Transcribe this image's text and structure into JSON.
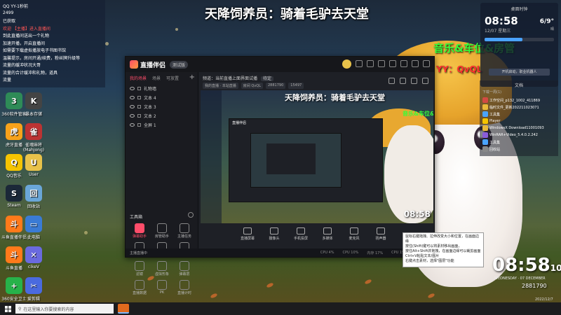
{
  "window": {
    "top_title": "天降饲养员：骑着毛驴去天堂",
    "green_overlay": "音乐&车位&房管",
    "red_overlay": "YY：QvQL"
  },
  "qq_panel": {
    "lines": [
      {
        "text": "QQ  YY-1秒前",
        "red": false
      },
      {
        "text": "2499",
        "red": false
      },
      {
        "text": "已获取",
        "red": false
      },
      {
        "text": "欢迎 【主播】进入直播间",
        "red": true
      },
      {
        "text": "到此直播间送出一个礼物",
        "red": false
      },
      {
        "text": "加速开播，开启直播间",
        "red": false
      },
      {
        "text": "如需要下载虚拟播放电子书图书馆",
        "red": false
      },
      {
        "text": "温馨提示，房间开通/续费，粉丝牌升级等",
        "red": false
      },
      {
        "text": "流量的缓冲状况大哥",
        "red": false
      },
      {
        "text": "流量的合计缓冲和礼物，道具",
        "red": false
      },
      {
        "text": "流量",
        "red": false
      }
    ]
  },
  "desktop_icons": [
    {
      "label": "360软件管家",
      "glyph": "3",
      "color": "#2e8b57"
    },
    {
      "label": "暴本存储",
      "glyph": "K",
      "color": "#444"
    },
    {
      "label": "虎牙直播",
      "glyph": "虎",
      "color": "#f7a21b"
    },
    {
      "label": "雀魂麻将 (Mahjong)",
      "glyph": "雀",
      "color": "#b33"
    },
    {
      "label": "QQ音乐",
      "glyph": "Q",
      "color": "#f5c400"
    },
    {
      "label": "User",
      "glyph": "U",
      "color": "#e8c24a"
    },
    {
      "label": "Steam",
      "glyph": "S",
      "color": "#1b2838"
    },
    {
      "label": "回收站",
      "glyph": "回",
      "color": "#6aa6d8"
    },
    {
      "label": "斗鱼直播伴侣",
      "glyph": "斗",
      "color": "#ff7a1a"
    },
    {
      "label": "此电脑",
      "glyph": "▭",
      "color": "#3a7bd5"
    },
    {
      "label": "斗鱼直播",
      "glyph": "斗",
      "color": "#ff7a1a"
    },
    {
      "label": "cikeV",
      "glyph": "✕",
      "color": "#6a6adf"
    },
    {
      "label": "360安全卫士",
      "glyph": "+",
      "color": "#27b24a"
    },
    {
      "label": "爱剪辑",
      "glyph": "✂",
      "color": "#4a6adf"
    }
  ],
  "app": {
    "name": "直播伴侣",
    "version": "测试版",
    "left_tabs": [
      "我的场景",
      "场景",
      "可放置"
    ],
    "scenes": [
      "礼物墙",
      "文本 4",
      "文本 3",
      "文本 2",
      "全屏 1"
    ],
    "toolbox_label": "工具箱",
    "tools": [
      "弹幕助手",
      "房管助手",
      "主播任务",
      "视频连麦",
      "多人连麦",
      "背景音乐",
      "滤镜",
      "虚拟形象",
      "弹幕层",
      "直播数据",
      "PK",
      "直播计时"
    ],
    "footer_note": "主播直播中",
    "info_line": "频道：当前直播上面界面试播",
    "info_tag": "待定",
    "info_pills": [
      "我的直播 · 本站直播",
      "房间 QvQL",
      "2881790",
      "15497"
    ],
    "preview": {
      "title": "天降饲养员：骑着毛驴去天堂",
      "green": "音乐&车位&房管",
      "clock": "08:58",
      "nested_app_name": "直播伴侣"
    },
    "controls": [
      "直播屏幕",
      "摄像头",
      "手机投屏",
      "多媒体",
      "麦克风",
      "扬声器"
    ],
    "status": [
      "CPU 4%",
      "CPU 10%",
      "内存 17%",
      "CPU 15%",
      "开始直播"
    ]
  },
  "tooltip": {
    "lines": [
      "鼠标右键拖拽、拉伸改变大小和位置，在画面边缘",
      "按住(Shift)键可以将素材移出画面，",
      "按住Alt+Shift并拖拽，在画面边缘可以裁剪画面",
      "Ctrl+V粘贴文本/图片",
      "右键点击素材，选择\"图层\"功能"
    ]
  },
  "right_widget": {
    "label": "桌面时钟",
    "time": "08:58",
    "date": "12/07 星期三",
    "temp": "6/9°",
    "cond": "晴",
    "bar_fill": 0.55,
    "button": "开机启动，职业机器人"
  },
  "files": {
    "title": "文档",
    "header": "下载一周(1)",
    "rows": [
      {
        "name": "工作空间_p132_1002_411869",
        "color": "#d24a43"
      },
      {
        "name": "临时文件_更新202211023071",
        "color": "#e8b93a"
      },
      {
        "name": "工具集",
        "color": "#4aa3ff"
      },
      {
        "name": "Player",
        "color": "#f5c400"
      },
      {
        "name": "WindowsX Download11001093",
        "color": "#e8b93a"
      },
      {
        "name": "WinRAR+Video_5.4.0.2.242",
        "color": "#8a5cd8"
      },
      {
        "name": "工具集",
        "color": "#4aa3ff"
      },
      {
        "name": "回收站",
        "color": "#888"
      }
    ]
  },
  "big_clock": {
    "hm": "08:58",
    "sec": "10",
    "date": "WEDNESDAY · 07 DECEMBER",
    "number": "2881790",
    "date2": "2022/12/7"
  },
  "taskbar": {
    "search_placeholder": "在这里输入你要搜索的内容"
  }
}
